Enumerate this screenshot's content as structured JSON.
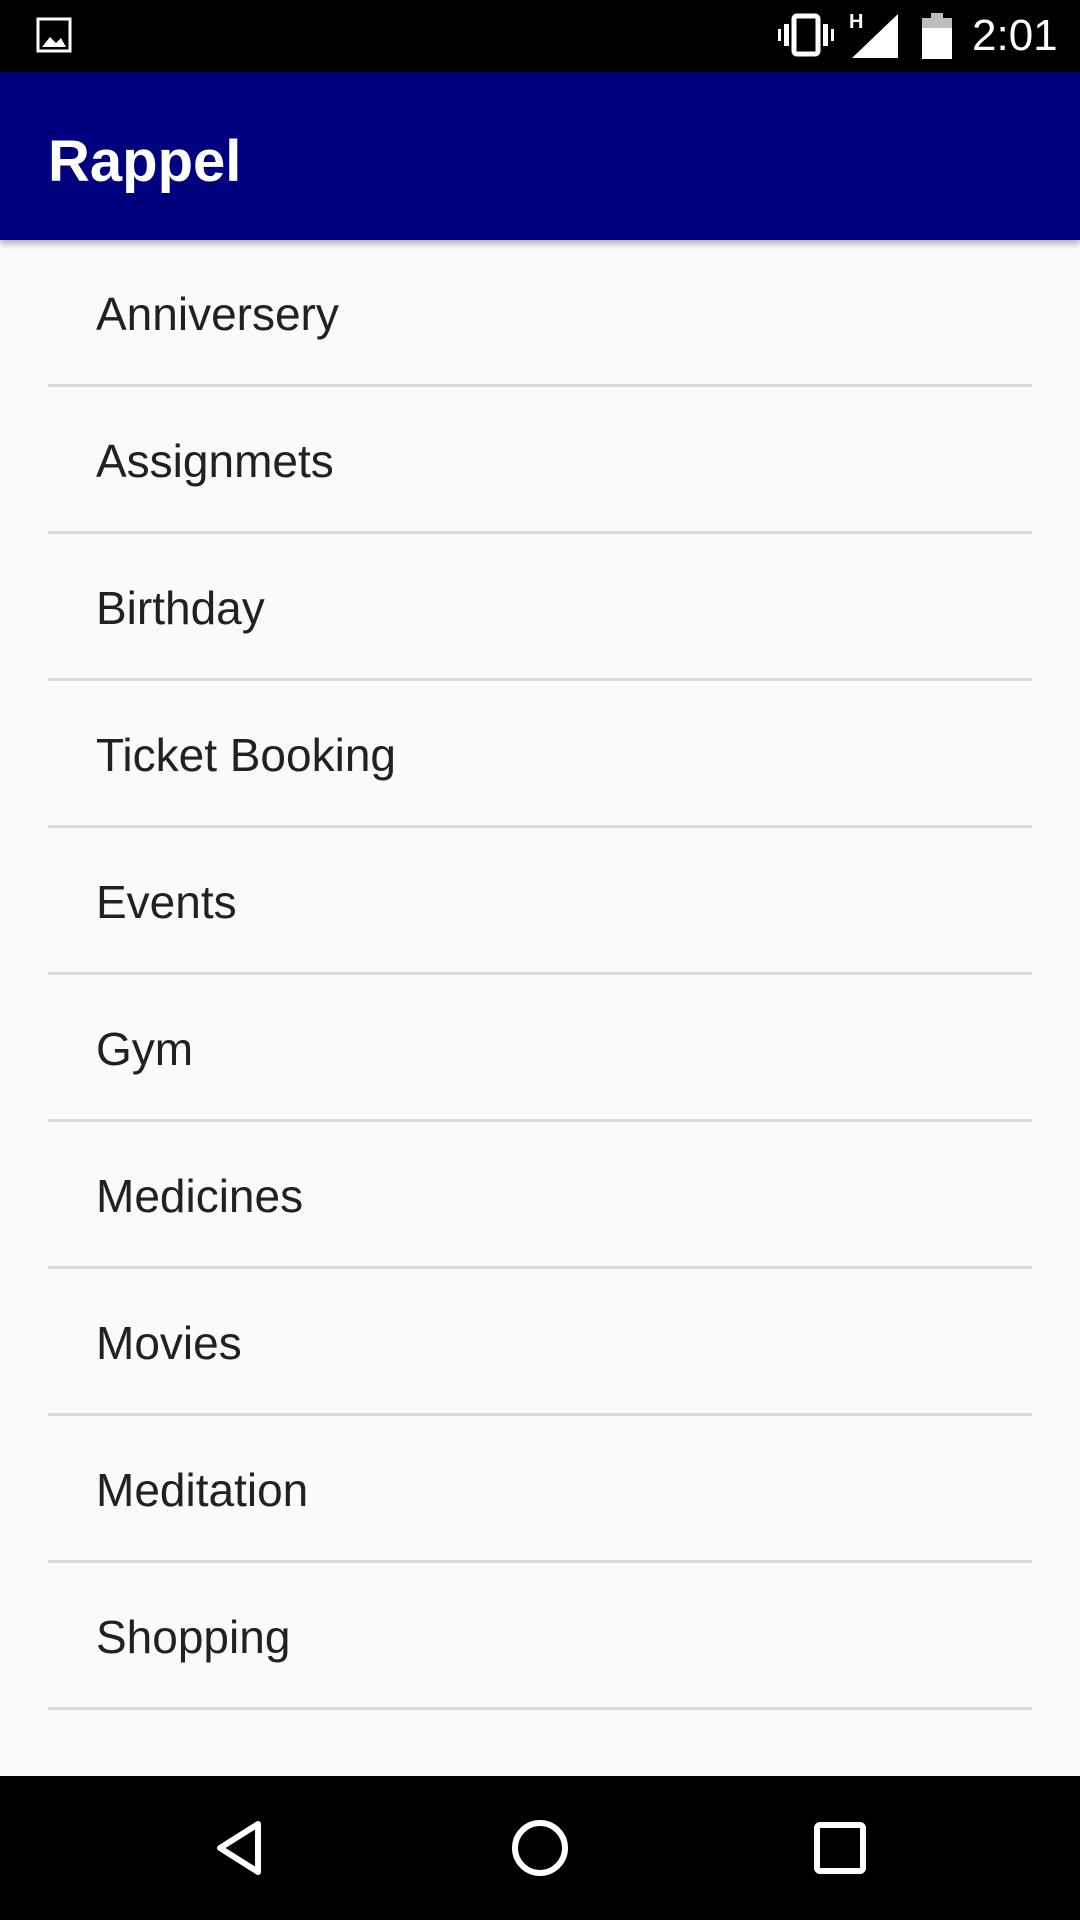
{
  "status_bar": {
    "time": "2:01",
    "network_type": "H",
    "icons": [
      "image-icon",
      "vibrate-icon",
      "signal-icon",
      "battery-icon"
    ]
  },
  "app_bar": {
    "title": "Rappel",
    "color": "#00007f"
  },
  "list": {
    "items": [
      {
        "label": "Anniversery"
      },
      {
        "label": "Assignmets"
      },
      {
        "label": "Birthday"
      },
      {
        "label": "Ticket Booking"
      },
      {
        "label": "Events"
      },
      {
        "label": "Gym"
      },
      {
        "label": "Medicines"
      },
      {
        "label": "Movies"
      },
      {
        "label": "Meditation"
      },
      {
        "label": "Shopping"
      }
    ]
  },
  "nav_bar": {
    "buttons": [
      "back-icon",
      "home-icon",
      "recents-icon"
    ]
  }
}
